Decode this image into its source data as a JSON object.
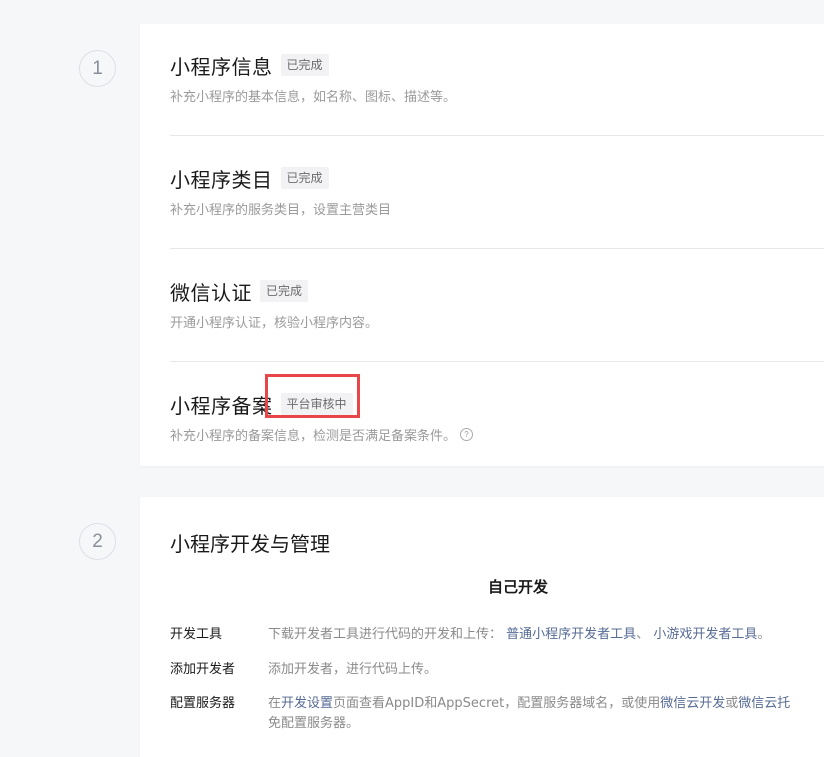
{
  "step1": {
    "number": "1",
    "items": [
      {
        "title": "小程序信息",
        "badge": "已完成",
        "desc": "补充小程序的基本信息，如名称、图标、描述等。"
      },
      {
        "title": "小程序类目",
        "badge": "已完成",
        "desc": "补充小程序的服务类目，设置主营类目"
      },
      {
        "title": "微信认证",
        "badge": "已完成",
        "desc": "开通小程序认证，核验小程序内容。"
      },
      {
        "title": "小程序备案",
        "badge": "平台审核中",
        "desc": "补充小程序的备案信息，检测是否满足备案条件。",
        "help_glyph": "?"
      }
    ]
  },
  "step2": {
    "number": "2",
    "title": "小程序开发与管理",
    "subheading": "自己开发",
    "rows": [
      {
        "label": "开发工具",
        "text": "下载开发者工具进行代码的开发和上传：",
        "link1": "普通小程序开发者工具",
        "sep": "、",
        "link2": "小游戏开发者工具",
        "end": "。"
      },
      {
        "label": "添加开发者",
        "text": "添加开发者，进行代码上传。"
      },
      {
        "label": "配置服务器",
        "pre": "在",
        "link1": "开发设置",
        "mid": "页面查看AppID和AppSecret，配置服务器域名，或使用",
        "link2": "微信云开发",
        "or": "或",
        "link3": "微信云托",
        "line2": "免配置服务器。"
      }
    ]
  },
  "colors": {
    "accent_link": "#576b95",
    "highlight_border": "#e8474a"
  }
}
